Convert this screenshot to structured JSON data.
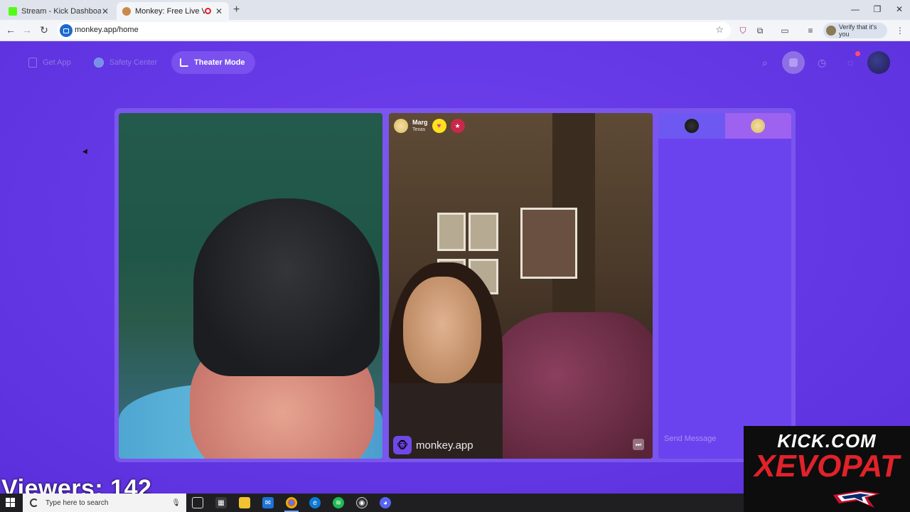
{
  "browser": {
    "tabs": [
      {
        "title": "Stream - Kick Dashboard",
        "favicon_color": "#53fc18"
      },
      {
        "title": "Monkey: Free Live Video Ch",
        "favicon_color": "#c98a4b"
      }
    ],
    "new_tab_symbol": "+",
    "url": "monkey.app/home",
    "profile_button": "Verify that it's you"
  },
  "nav": {
    "get_app": "Get App",
    "safety_center": "Safety Center",
    "theater_mode": "Theater Mode"
  },
  "partner": {
    "name": "Marg",
    "location": "Texas"
  },
  "watermark": "monkey.app",
  "chat": {
    "placeholder": "Send Message"
  },
  "overlay": {
    "viewers": "Viewers: 142",
    "kick_line1": "KICK.COM",
    "kick_line2": "XEVOPAT"
  },
  "taskbar": {
    "search_placeholder": "Type here to search"
  },
  "colors": {
    "page_bg": "#6a3ce9",
    "accent": "#7a51ee",
    "kick_red": "#e0222a"
  }
}
